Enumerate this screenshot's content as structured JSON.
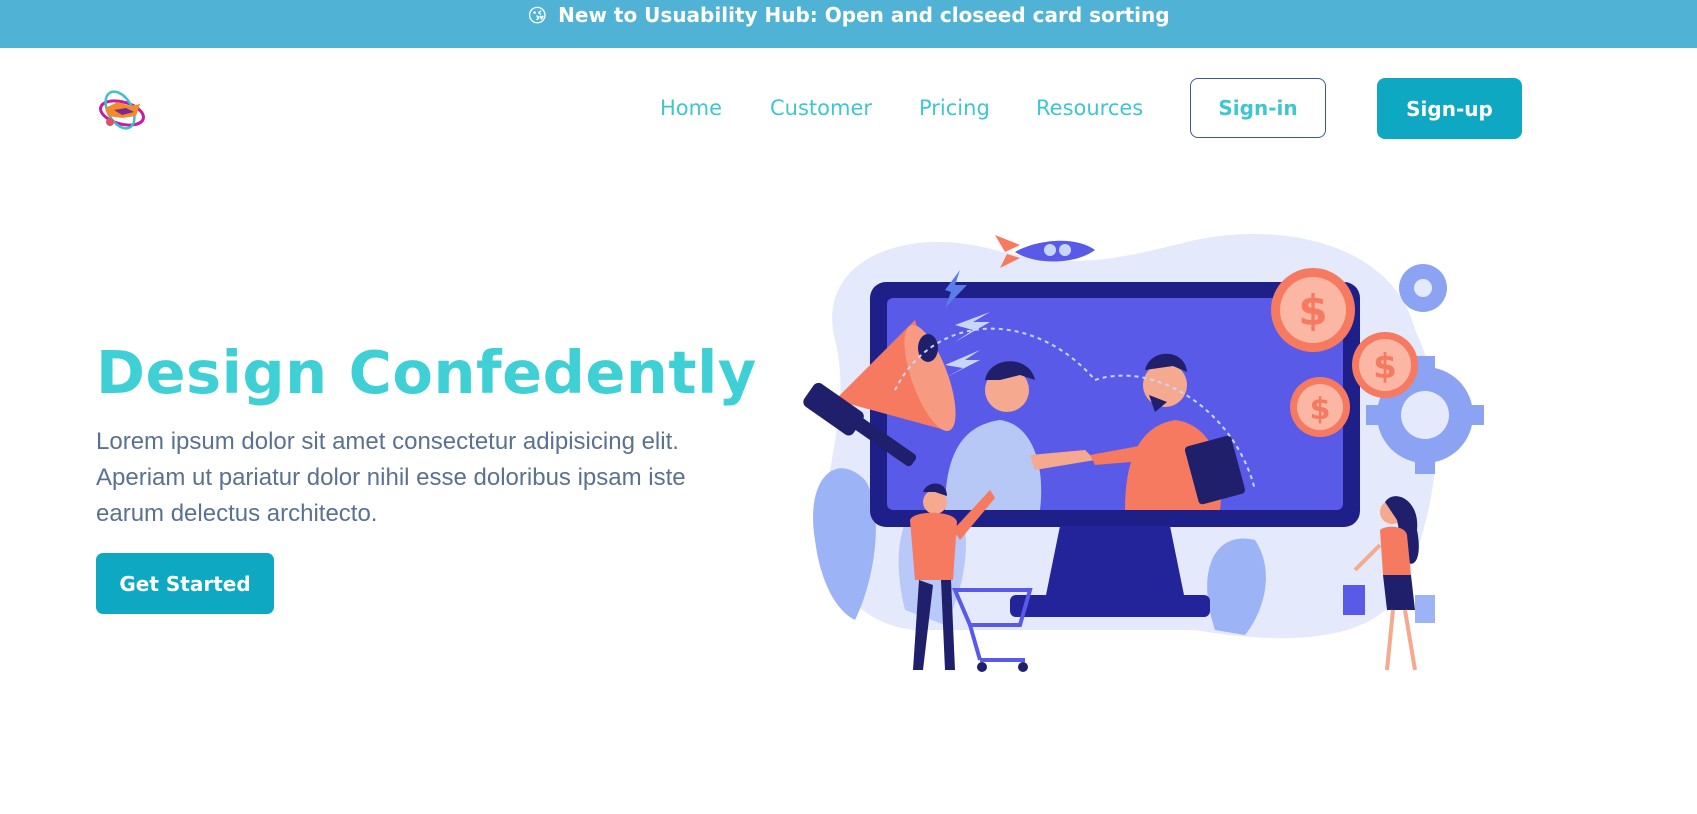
{
  "announcement": {
    "emoji": "😘",
    "text": "New to Usuability Hub: Open and closeed card sorting"
  },
  "logo": {
    "icon": "handshake-logo-icon"
  },
  "nav": {
    "items": [
      {
        "label": "Home"
      },
      {
        "label": "Customer"
      },
      {
        "label": "Pricing"
      },
      {
        "label": "Resources"
      }
    ],
    "signin_label": "Sign-in",
    "signup_label": "Sign-up"
  },
  "hero": {
    "title": "Design Confedently",
    "text": "Lorem ipsum dolor sit amet consectetur adipisicing elit. Aperiam ut pariatur dolor nihil esse doloribus ipsam iste earum delectus architecto.",
    "cta_label": "Get Started",
    "illustration": {
      "icon": "business-handshake-illustration"
    }
  },
  "colors": {
    "banner": "#50b3d6",
    "accent": "#3ec6d1",
    "button": "#0fa8c3",
    "body_text": "#5a7290"
  }
}
